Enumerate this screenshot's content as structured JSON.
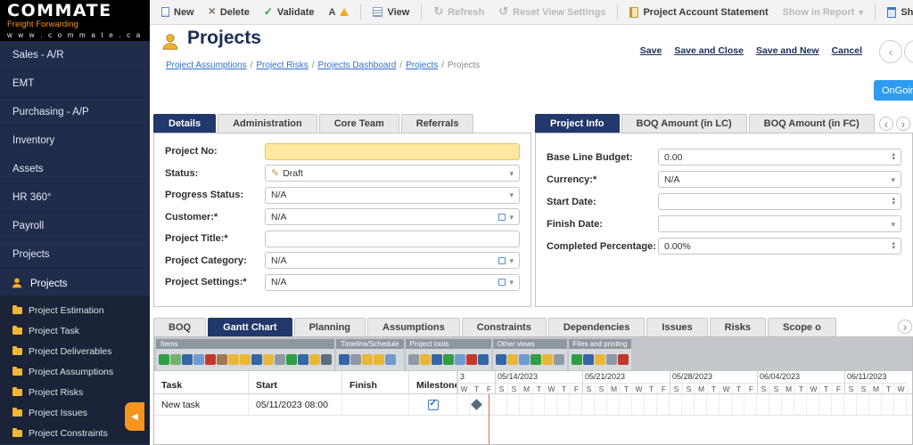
{
  "app": {
    "logo": "COMMATE",
    "url": "w w w . c o m m a t e . c a",
    "module": "Freight Forwarding"
  },
  "sidebar": {
    "items": [
      "Sales - A/R",
      "EMT",
      "Purchasing - A/P",
      "Inventory",
      "Assets",
      "HR 360°",
      "Payroll",
      "Projects"
    ],
    "section_label": "Projects",
    "subitems": [
      "Project Estimation",
      "Project Task",
      "Project Deliverables",
      "Project Assumptions",
      "Project Risks",
      "Project Issues",
      "Project Constraints"
    ]
  },
  "toolbar": {
    "new_label": "New",
    "delete_label": "Delete",
    "validate_label": "Validate",
    "view_label": "View",
    "refresh_label": "Refresh",
    "reset_label": "Reset View Settings",
    "statement_label": "Project Account Statement",
    "report_label": "Show in Report",
    "audit_label": "Show Audit Logs"
  },
  "header": {
    "title": "Projects",
    "breadcrumb": [
      "Project Assumptions",
      "Project Risks",
      "Projects Dashboard",
      "Projects",
      "Projects"
    ],
    "save_label": "Save",
    "save_close_label": "Save and Close",
    "save_new_label": "Save and New",
    "cancel_label": "Cancel",
    "status_button": "OnGoing"
  },
  "details_panel": {
    "tabs": [
      "Details",
      "Administration",
      "Core Team",
      "Referrals"
    ],
    "fields": [
      {
        "label": "Project No:",
        "value": ""
      },
      {
        "label": "Status:",
        "value": "Draft"
      },
      {
        "label": "Progress Status:",
        "value": "N/A"
      },
      {
        "label": "Customer:*",
        "value": "N/A"
      },
      {
        "label": "Project Title:*",
        "value": ""
      },
      {
        "label": "Project Category:",
        "value": "N/A"
      },
      {
        "label": "Project Settings:*",
        "value": "N/A"
      }
    ]
  },
  "info_panel": {
    "tabs": [
      "Project Info",
      "BOQ Amount (in LC)",
      "BOQ Amount (in FC)"
    ],
    "fields": [
      {
        "label": "Base Line Budget:",
        "value": "0.00"
      },
      {
        "label": "Currency:*",
        "value": "N/A"
      },
      {
        "label": "Start Date:",
        "value": ""
      },
      {
        "label": "Finish Date:",
        "value": ""
      },
      {
        "label": "Completed Percentage:",
        "value": "0.00%"
      }
    ]
  },
  "bottom_tabs": [
    "BOQ",
    "Gantt Chart",
    "Planning",
    "Assumptions",
    "Constraints",
    "Dependencies",
    "Issues",
    "Risks",
    "Scope o"
  ],
  "gantt": {
    "toolbar_groups": [
      {
        "label": "Items",
        "icons": [
          "#2f9e44",
          "#74b06f",
          "#3465a4",
          "#6f9bd1",
          "#c0392b",
          "#a07850",
          "#e8b73a",
          "#e8b73a",
          "#3465a4",
          "#e8b73a",
          "#8d9aa5",
          "#2f9e44",
          "#3465a4",
          "#e8b73a",
          "#5d6d7e"
        ]
      },
      {
        "label": "Timeline/Schedule",
        "icons": [
          "#3465a4",
          "#8d9aa5",
          "#e8b73a",
          "#e8b73a",
          "#6f9bd1"
        ]
      },
      {
        "label": "Project tools",
        "icons": [
          "#8d9aa5",
          "#e8b73a",
          "#3465a4",
          "#2f9e44",
          "#6f9bd1",
          "#c0392b",
          "#3465a4"
        ]
      },
      {
        "label": "Other views",
        "icons": [
          "#3465a4",
          "#e8b73a",
          "#6f9bd1",
          "#2f9e44",
          "#e8b73a",
          "#8d9aa5"
        ]
      },
      {
        "label": "Files and printing",
        "icons": [
          "#2f9e44",
          "#3465a4",
          "#e8b73a",
          "#8d9aa5",
          "#c0392b"
        ]
      }
    ],
    "columns": [
      "Task",
      "Start",
      "Finish",
      "Milestone"
    ],
    "weeks": [
      {
        "label": "3",
        "days": [
          "W",
          "T",
          "F"
        ]
      },
      {
        "label": "05/14/2023",
        "days": [
          "S",
          "S",
          "M",
          "T",
          "W",
          "T",
          "F"
        ]
      },
      {
        "label": "05/21/2023",
        "days": [
          "S",
          "S",
          "M",
          "T",
          "W",
          "T",
          "F"
        ]
      },
      {
        "label": "05/28/2023",
        "days": [
          "S",
          "S",
          "M",
          "T",
          "W",
          "T",
          "F"
        ]
      },
      {
        "label": "06/04/2023",
        "days": [
          "S",
          "S",
          "M",
          "T",
          "W",
          "T",
          "F"
        ]
      },
      {
        "label": "06/11/2023",
        "days": [
          "S",
          "S",
          "M",
          "T",
          "W"
        ]
      }
    ],
    "rows": [
      {
        "task": "New task",
        "start": "05/11/2023 08:00",
        "finish": "",
        "milestone": true
      }
    ]
  }
}
